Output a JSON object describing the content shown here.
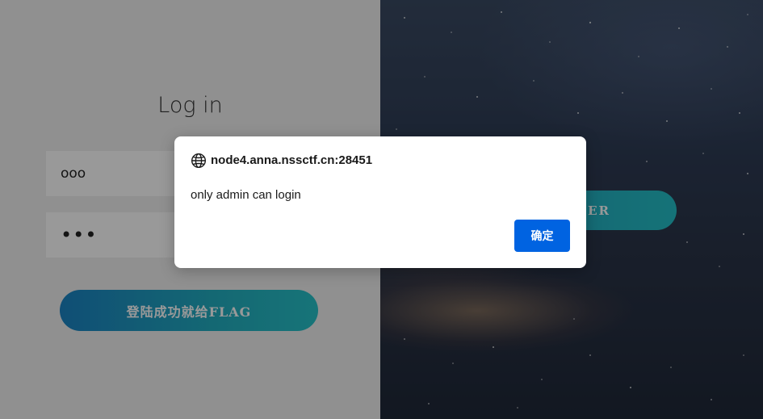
{
  "login": {
    "title": "Log in",
    "username_value": "ooo",
    "password_value": "•••",
    "submit_label": "登陆成功就给FLAG"
  },
  "register": {
    "label": "TER"
  },
  "dialog": {
    "icon": "globe-icon",
    "origin": "node4.anna.nssctf.cn:28451",
    "message": "only admin can login",
    "ok_label": "确定"
  },
  "colors": {
    "primary_button": "#0063e1",
    "gradient_start": "#1b83c4",
    "gradient_end": "#27c2c9"
  }
}
